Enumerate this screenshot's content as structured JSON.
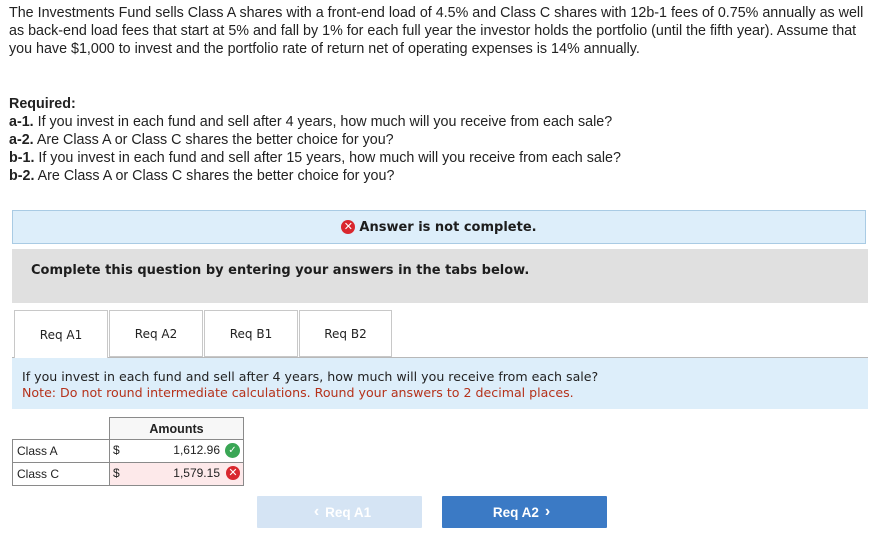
{
  "question": {
    "body": "The Investments Fund sells Class A shares with a front-end load of 4.5% and Class C shares with 12b-1 fees of 0.75% annually as well as back-end load fees that start at 5% and fall by 1% for each full year the investor holds the portfolio (until the fifth year). Assume that you have $1,000 to invest and the portfolio rate of return net of operating expenses is 14% annually."
  },
  "required": {
    "heading": "Required:",
    "items": [
      {
        "tag": "a-1.",
        "text": " If you invest in each fund and sell after 4 years, how much will you receive from each sale?"
      },
      {
        "tag": "a-2.",
        "text": " Are Class A or Class C shares the better choice for you?"
      },
      {
        "tag": "b-1.",
        "text": " If you invest in each fund and sell after 15 years, how much will you receive from each sale?"
      },
      {
        "tag": "b-2.",
        "text": " Are Class A or Class C shares the better choice for you?"
      }
    ]
  },
  "banner": {
    "text": "Answer is not complete.",
    "icon": "x-circle-icon",
    "color": "#d9272e"
  },
  "complete_bar": {
    "text": "Complete this question by entering your answers in the tabs below."
  },
  "tabs": [
    {
      "label": "Req A1"
    },
    {
      "label": "Req A2"
    },
    {
      "label": "Req B1"
    },
    {
      "label": "Req B2"
    }
  ],
  "instructions": {
    "question": "If you invest in each fund and sell after 4 years, how much will you receive from each sale?",
    "note": "Note: Do not round intermediate calculations. Round your answers to 2 decimal places."
  },
  "table": {
    "header": "Amounts",
    "rows": [
      {
        "label": "Class A",
        "currency": "$",
        "value": "1,612.96",
        "status": "correct"
      },
      {
        "label": "Class C",
        "currency": "$",
        "value": "1,579.15",
        "status": "incorrect"
      }
    ]
  },
  "nav": {
    "prev_label": "Req A1",
    "next_label": "Req A2",
    "prev_icon": "chevron-left-icon",
    "next_icon": "chevron-right-icon"
  },
  "colors": {
    "accent": "#3b7ac5",
    "correct": "#3aa655",
    "incorrect": "#d9272e",
    "note": "#b5321b"
  }
}
